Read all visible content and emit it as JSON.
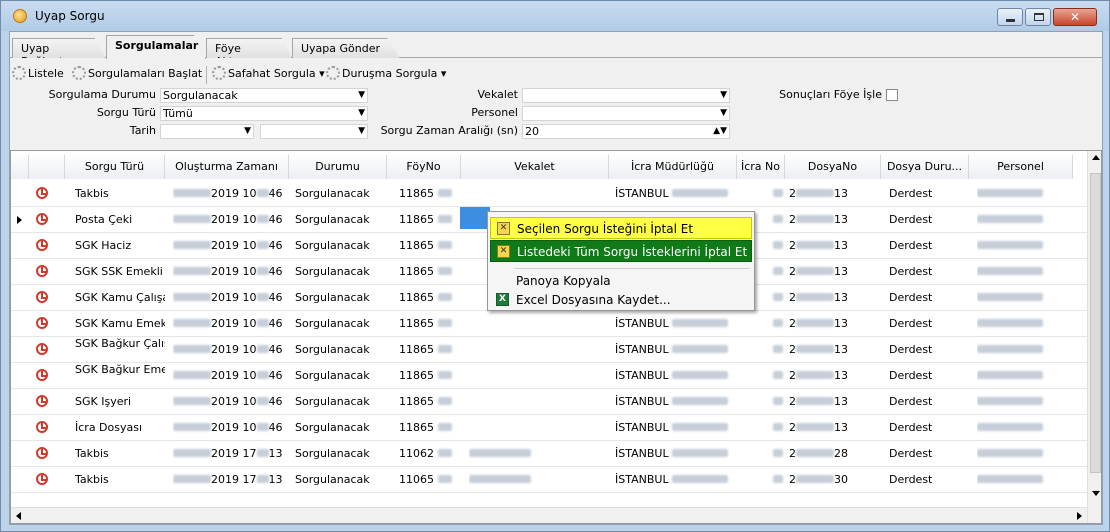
{
  "window": {
    "title": "Uyap Sorgu"
  },
  "tabs": [
    {
      "label": "Uyap Bağlantı"
    },
    {
      "label": "Sorgulamalar"
    },
    {
      "label": "Föye Aktarım"
    },
    {
      "label": "Uyapa Gönder"
    }
  ],
  "toolbar": {
    "listele": "Listele",
    "baslat": "Sorgulamaları Başlat",
    "safahat": "Safahat Sorgula ▾",
    "durusma": "Duruşma Sorgula ▾"
  },
  "filters": {
    "sorgulama_durumu_label": "Sorgulama Durumu",
    "sorgulama_durumu_value": "Sorgulanacak",
    "sorgu_turu_label": "Sorgu Türü",
    "sorgu_turu_value": "Tümü",
    "tarih_label": "Tarih",
    "tarih_value": "",
    "vekalet_label": "Vekalet",
    "vekalet_value": "",
    "personel_label": "Personel",
    "personel_value": "",
    "zaman_label": "Sorgu Zaman Aralığı (sn)",
    "zaman_value": "20",
    "sonuclar_label": "Sonuçları Föye İşle"
  },
  "grid": {
    "columns": [
      "Sorgu Türü",
      "Oluşturma Zamanı",
      "Durumu",
      "FöyNo",
      "Vekalet",
      "İcra Müdürlüğü",
      "İcra No",
      "DosyaNo",
      "Dosya Duru...",
      "Personel"
    ],
    "rows": [
      {
        "tur": "Takbis",
        "zaman": "2019 10",
        "zaman2": "46",
        "durum": "Sorgulanacak",
        "foy": "11865",
        "icra": "İSTANBUL",
        "dosya_pre": "2",
        "dosya": "13",
        "dd": "Derdest"
      },
      {
        "tur": "Posta Çeki",
        "zaman": "2019 10",
        "zaman2": "46",
        "durum": "Sorgulanacak",
        "foy": "11865",
        "icra": "",
        "dosya_pre": "2",
        "dosya": "13",
        "dd": "Derdest"
      },
      {
        "tur": "SGK Haciz",
        "zaman": "2019 10",
        "zaman2": "46",
        "durum": "Sorgulanacak",
        "foy": "11865",
        "icra": "",
        "dosya_pre": "2",
        "dosya": "13",
        "dd": "Derdest"
      },
      {
        "tur": "SGK SSK Emekli",
        "zaman": "2019 10",
        "zaman2": "46",
        "durum": "Sorgulanacak",
        "foy": "11865",
        "icra": "",
        "dosya_pre": "2",
        "dosya": "13",
        "dd": "Derdest"
      },
      {
        "tur": "SGK Kamu Çalışan",
        "zaman": "2019 10",
        "zaman2": "46",
        "durum": "Sorgulanacak",
        "foy": "11865",
        "icra": "",
        "dosya_pre": "2",
        "dosya": "13",
        "dd": "Derdest"
      },
      {
        "tur": "SGK Kamu Emekli",
        "zaman": "2019 10",
        "zaman2": "46",
        "durum": "Sorgulanacak",
        "foy": "11865",
        "icra": "İSTANBUL",
        "dosya_pre": "2",
        "dosya": "13",
        "dd": "Derdest"
      },
      {
        "tur": "SGK Bağkur Çalışan",
        "zaman": "2019 10",
        "zaman2": "46",
        "durum": "Sorgulanacak",
        "foy": "11865",
        "icra": "İSTANBUL",
        "dosya_pre": "2",
        "dosya": "13",
        "dd": "Derdest"
      },
      {
        "tur": "SGK Bağkur Emekli",
        "zaman": "2019 10",
        "zaman2": "46",
        "durum": "Sorgulanacak",
        "foy": "11865",
        "icra": "İSTANBUL",
        "dosya_pre": "2",
        "dosya": "13",
        "dd": "Derdest"
      },
      {
        "tur": "SGK Işyeri",
        "zaman": "2019 10",
        "zaman2": "46",
        "durum": "Sorgulanacak",
        "foy": "11865",
        "icra": "İSTANBUL",
        "dosya_pre": "2",
        "dosya": "13",
        "dd": "Derdest"
      },
      {
        "tur": "İcra Dosyası",
        "zaman": "2019 10",
        "zaman2": "46",
        "durum": "Sorgulanacak",
        "foy": "11865",
        "icra": "İSTANBUL",
        "dosya_pre": "2",
        "dosya": "13",
        "dd": "Derdest"
      },
      {
        "tur": "Takbis",
        "zaman": "2019 17",
        "zaman2": "13",
        "durum": "Sorgulanacak",
        "foy": "11062",
        "icra": "İSTANBUL",
        "dosya_pre": "2",
        "dosya": "28",
        "dd": "Derdest"
      },
      {
        "tur": "Takbis",
        "zaman": "2019 17",
        "zaman2": "13",
        "durum": "Sorgulanacak",
        "foy": "11065",
        "icra": "İSTANBUL",
        "dosya_pre": "2",
        "dosya": "30",
        "dd": "Derdest"
      }
    ]
  },
  "context_menu": {
    "item1": "Seçilen Sorgu İsteğini İptal Et",
    "item2": "Listedeki Tüm Sorgu İsteklerini İptal Et",
    "item3": "Panoya Kopyala",
    "item4": "Excel Dosyasına Kaydet..."
  },
  "colors": {
    "highlight_yellow": "#ffff44",
    "highlight_green": "#117a18",
    "clock_red": "#d13a2b"
  }
}
